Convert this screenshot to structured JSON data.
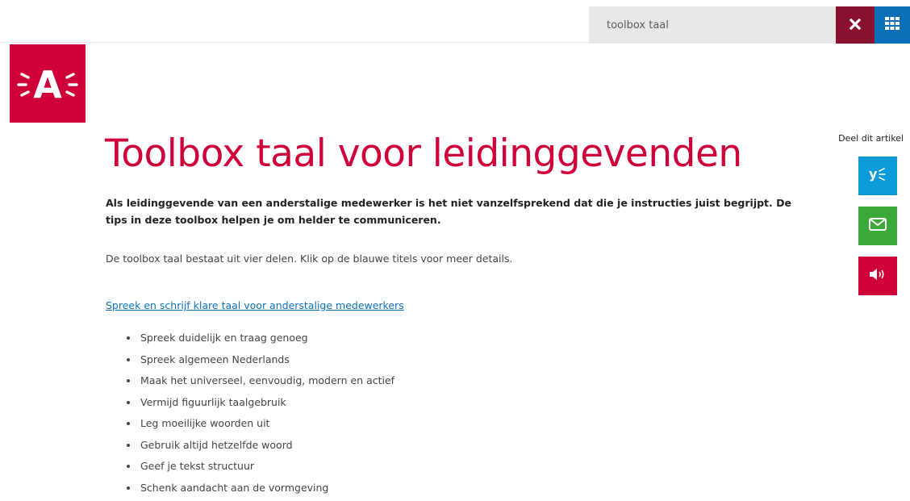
{
  "header": {
    "search_value": "toolbox taal",
    "close_icon": "close-icon",
    "apps_icon": "grid-icon"
  },
  "logo": {
    "letter": "A",
    "color": "#cf0039"
  },
  "share": {
    "label": "Deel dit artikel",
    "buttons": [
      {
        "name": "yammer",
        "icon": "yammer-icon",
        "color": "#0c9ad8"
      },
      {
        "name": "email",
        "icon": "envelope-icon",
        "color": "#3aa935"
      },
      {
        "name": "read-aloud",
        "icon": "speaker-icon",
        "color": "#cf0039"
      }
    ]
  },
  "article": {
    "title": "Toolbox taal voor leidinggevenden",
    "intro": "Als leidinggevende van een anderstalige medewerker is het niet vanzelfsprekend dat die je instructies juist begrijpt. De tips in deze toolbox helpen je om helder te communiceren.",
    "body": "De toolbox taal bestaat uit vier delen. Klik op de blauwe titels voor meer details.",
    "section_link": "Spreek en schrijf klare taal voor anderstalige medewerkers",
    "bullets": [
      "Spreek duidelijk en traag genoeg",
      "Spreek algemeen Nederlands",
      "Maak het universeel, eenvoudig, modern en actief",
      "Vermijd figuurlijk taalgebruik",
      "Leg moeilijke woorden uit",
      "Gebruik altijd hetzelfde woord",
      "Geef je tekst structuur",
      "Schenk aandacht aan de vormgeving"
    ]
  },
  "colors": {
    "brand_red": "#cf0039",
    "dark_red": "#8a1130",
    "link_blue": "#0b70b8"
  }
}
